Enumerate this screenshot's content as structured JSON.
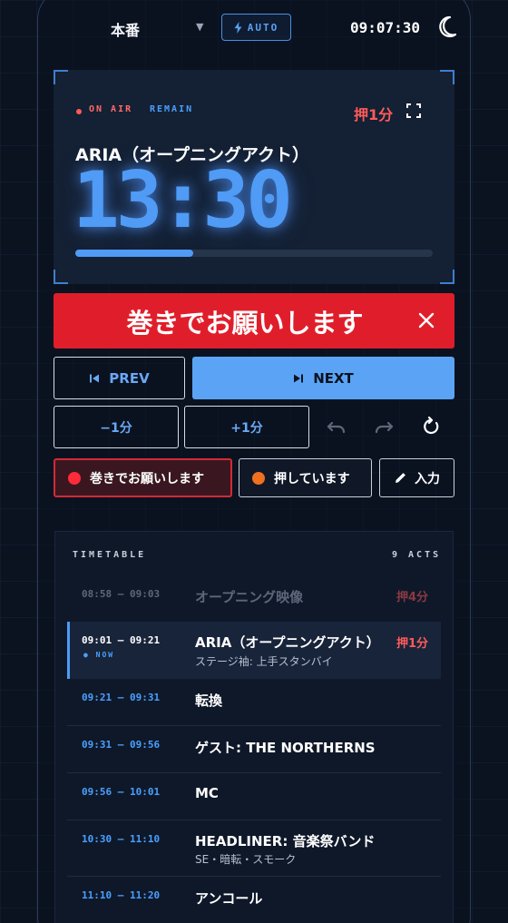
{
  "header": {
    "mode_label": "本番",
    "auto_label": "AUTO",
    "clock": "09:07:30"
  },
  "stage": {
    "on_air_label": "ON AIR",
    "remain_label": "REMAIN",
    "delay_badge": "押1分",
    "act_title": "ARIA（オープニングアクト）",
    "timer": "13:30",
    "progress": 0.33
  },
  "alert": {
    "message": "巻きでお願いします"
  },
  "controls": {
    "prev_label": "PREV",
    "next_label": "NEXT",
    "minus_label": "−1分",
    "plus_label": "+1分"
  },
  "quick": {
    "hurry_label": "巻きでお願いします",
    "delayed_label": "押しています",
    "input_label": "入力"
  },
  "timetable": {
    "title": "TIMETABLE",
    "count": "9 ACTS",
    "now_label": "NOW",
    "rows": [
      {
        "time": "08:58 – 09:03",
        "name": "オープニング映像",
        "sub": "",
        "delay": "押4分"
      },
      {
        "time": "09:01 – 09:21",
        "name": "ARIA（オープニングアクト）",
        "sub": "ステージ袖: 上手スタンバイ",
        "delay": "押1分"
      },
      {
        "time": "09:21 – 09:31",
        "name": "転換",
        "sub": "",
        "delay": ""
      },
      {
        "time": "09:31 – 09:56",
        "name": "ゲスト: THE NORTHERNS",
        "sub": "",
        "delay": ""
      },
      {
        "time": "09:56 – 10:01",
        "name": "MC",
        "sub": "",
        "delay": ""
      },
      {
        "time": "10:30 – 11:10",
        "name": "HEADLINER: 音楽祭バンド",
        "sub": "SE・暗転・スモーク",
        "delay": ""
      },
      {
        "time": "11:10 – 11:20",
        "name": "アンコール",
        "sub": "",
        "delay": ""
      }
    ]
  },
  "colors": {
    "accent": "#4f9bf5",
    "alert": "#e01e2b",
    "delay": "#ff5b5b",
    "background": "#0b1220"
  }
}
